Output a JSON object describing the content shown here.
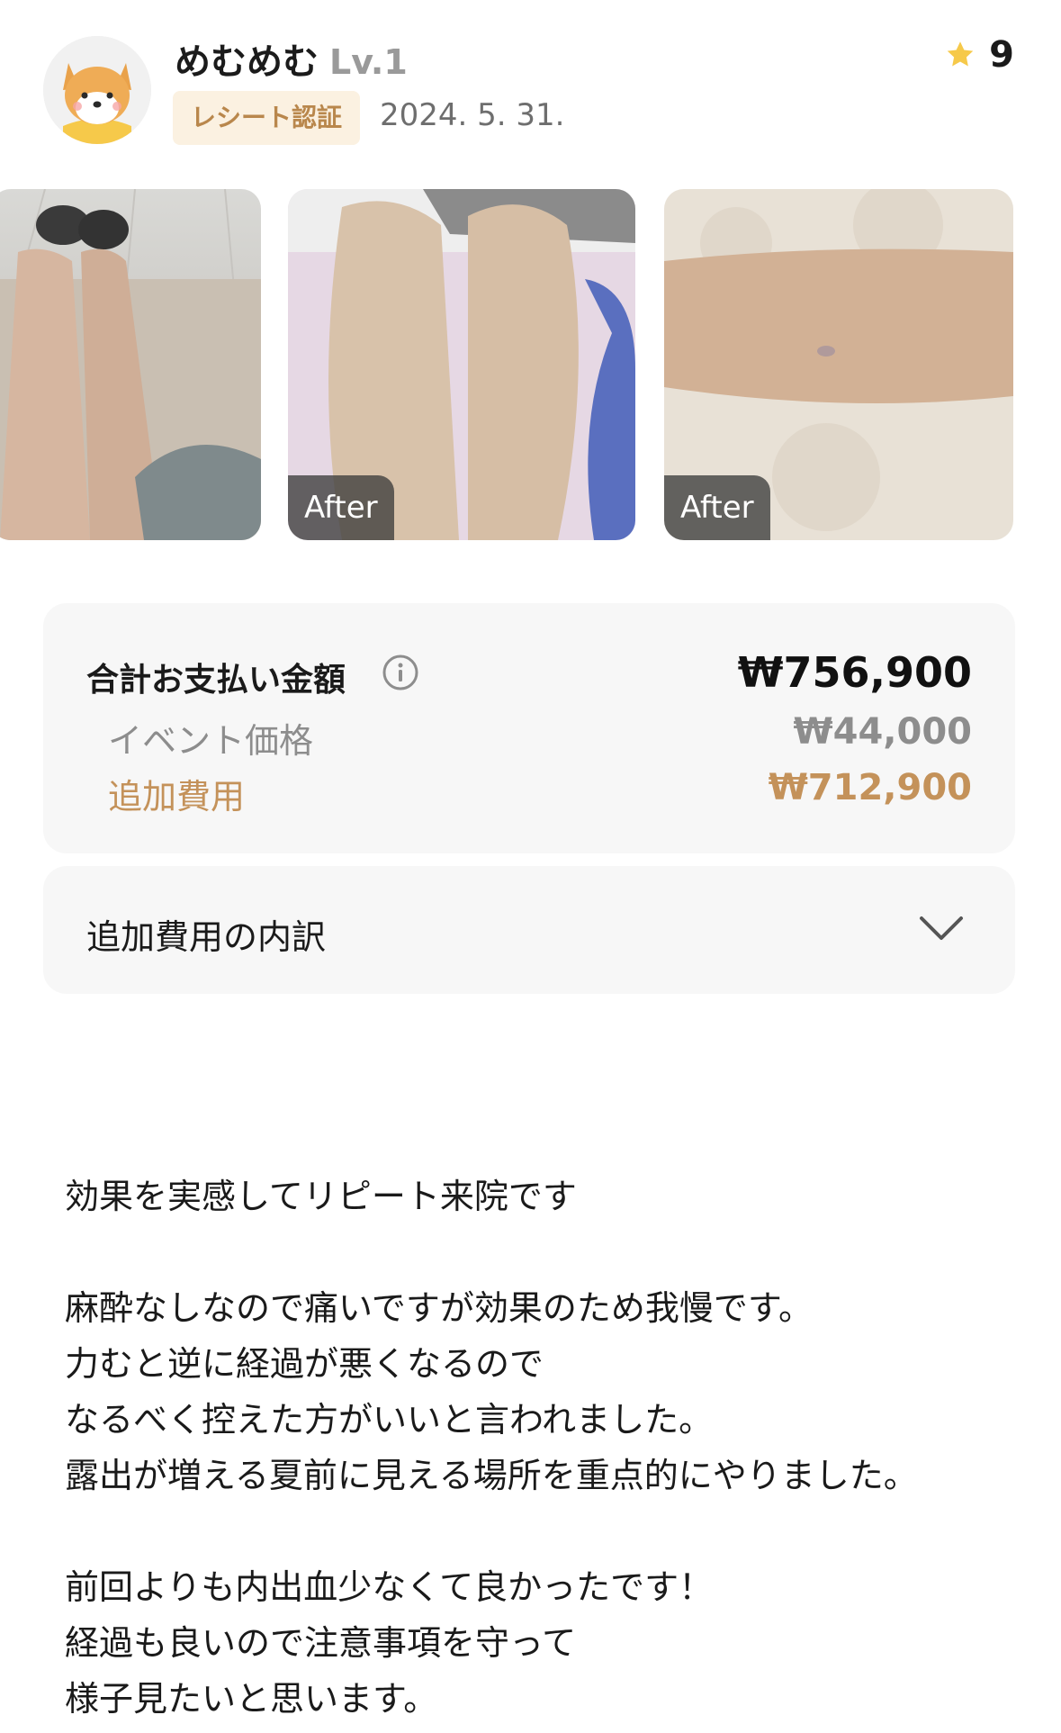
{
  "user": {
    "name": "めむめむ",
    "level": "Lv.1",
    "badge": "レシート認証",
    "date": "2024. 5. 31."
  },
  "rating": {
    "value": "9",
    "icon": "star-icon",
    "color": "#f6c94a"
  },
  "photos": [
    {
      "tag": ""
    },
    {
      "tag": "After"
    },
    {
      "tag": "After"
    }
  ],
  "pricing": {
    "total_label": "合計お支払い金額",
    "total_amount": "₩756,900",
    "event_label": "イベント価格",
    "event_amount": "₩44,000",
    "extra_label": "追加費用",
    "extra_amount": "₩712,900",
    "accent_color": "#c4925a"
  },
  "breakdown": {
    "label": "追加費用の内訳"
  },
  "review": {
    "body": "効果を実感してリピート来院です\n\n麻酔なしなので痛いですが効果のため我慢です。\n力むと逆に経過が悪くなるので\nなるべく控えた方がいいと言われました。\n露出が増える夏前に見える場所を重点的にやりました。\n\n前回よりも内出血少なくて良かったです！\n経過も良いので注意事項を守って\n様子見たいと思います。"
  }
}
